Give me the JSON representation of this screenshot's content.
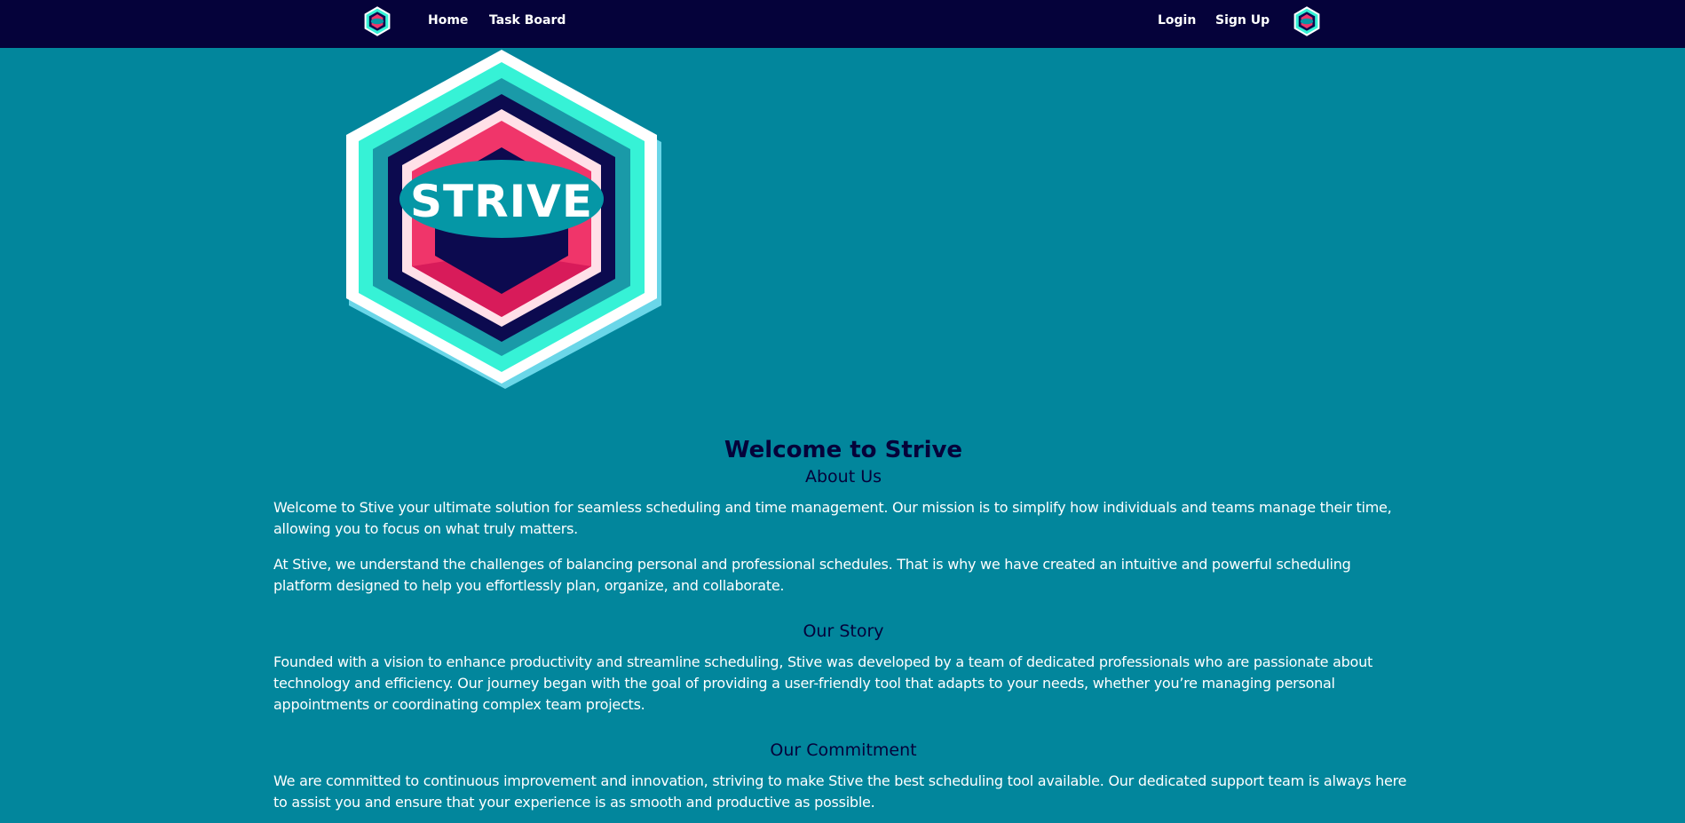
{
  "nav": {
    "home": "Home",
    "task_board": "Task Board",
    "login": "Login",
    "sign_up": "Sign Up"
  },
  "hero": {
    "logo_text": "STRIVE"
  },
  "main": {
    "welcome": "Welcome to Strive",
    "about_title": "About Us",
    "about_p1": "Welcome to Stive your ultimate solution for seamless scheduling and time management. Our mission is to simplify how individuals and teams manage their time, allowing you to focus on what truly matters.",
    "about_p2": "At Stive, we understand the challenges of balancing personal and professional schedules. That is why we have created an intuitive and powerful scheduling platform designed to help you effortlessly plan, organize, and collaborate.",
    "story_title": "Our Story",
    "story_p": "Founded with a vision to enhance productivity and streamline scheduling, Stive was developed by a team of dedicated professionals who are passionate about technology and efficiency. Our journey began with the goal of providing a user-friendly tool that adapts to your needs, whether you’re managing personal appointments or coordinating complex team projects.",
    "commitment_title": "Our Commitment",
    "commitment_p": "We are committed to continuous improvement and innovation, striving to make Stive the best scheduling tool available. Our dedicated support team is always here to assist you and ensure that your experience is as smooth and productive as possible."
  },
  "colors": {
    "background": "#02869c",
    "navbar": "#05023a",
    "heading": "#05023a",
    "body_text": "#ffffff",
    "logo_pink": "#f0356a",
    "logo_mint": "#36f2d6",
    "logo_navy": "#0c0a4f",
    "logo_teal_oval": "#0597a6"
  },
  "icons": {
    "nav_left": "strive-logo-icon",
    "nav_right": "strive-logo-icon"
  }
}
